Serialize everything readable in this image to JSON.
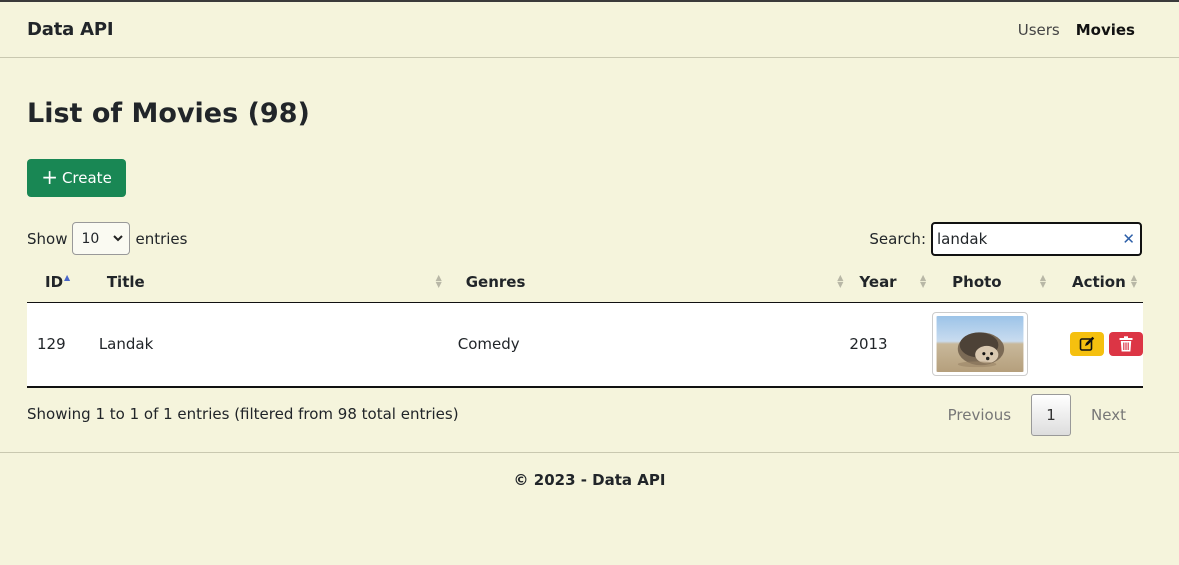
{
  "navbar": {
    "brand": "Data API",
    "links": [
      {
        "label": "Users",
        "active": false
      },
      {
        "label": "Movies",
        "active": true
      }
    ]
  },
  "page": {
    "title": "List of Movies (98)",
    "create_label": "Create"
  },
  "table_controls": {
    "show_label": "Show",
    "page_length": "10",
    "entries_label": "entries",
    "search_label": "Search:",
    "search_value": "landak"
  },
  "table": {
    "columns": [
      "ID",
      "Title",
      "Genres",
      "Year",
      "Photo",
      "Action"
    ],
    "sorted_column": "ID",
    "sort_direction": "asc",
    "rows": [
      {
        "id": "129",
        "title": "Landak",
        "genres": "Comedy",
        "year": "2013",
        "photo": "hedgehog photo"
      }
    ]
  },
  "pagination": {
    "info": "Showing 1 to 1 of 1 entries (filtered from 98 total entries)",
    "previous": "Previous",
    "current": "1",
    "next": "Next"
  },
  "footer": {
    "text": "© 2023 - Data API"
  },
  "colors": {
    "background": "#f5f4dc",
    "create_button": "#198754",
    "edit_button": "#f5c00f",
    "delete_button": "#dc3545",
    "sort_active": "#4a67c9"
  },
  "icons": {
    "create": "plus-icon",
    "edit": "edit-icon",
    "delete": "trash-icon",
    "clear_search": "close-icon",
    "select": "chevron-down-icon"
  }
}
